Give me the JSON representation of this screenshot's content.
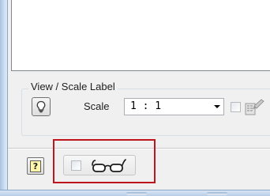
{
  "window": {
    "accent_border": "#a9c2df",
    "highlight_color": "#c0141c"
  },
  "list_panel": {
    "items": []
  },
  "view_scale_group": {
    "title": "View / Scale Label",
    "scale_label": "Scale",
    "scale_value": "1 : 1",
    "light_icon": "lightbulb-icon",
    "paint_icon": "paint-brush-icon"
  },
  "footer": {
    "help_label": "?",
    "help_icon": "help-icon",
    "glasses_icon": "glasses-icon"
  }
}
